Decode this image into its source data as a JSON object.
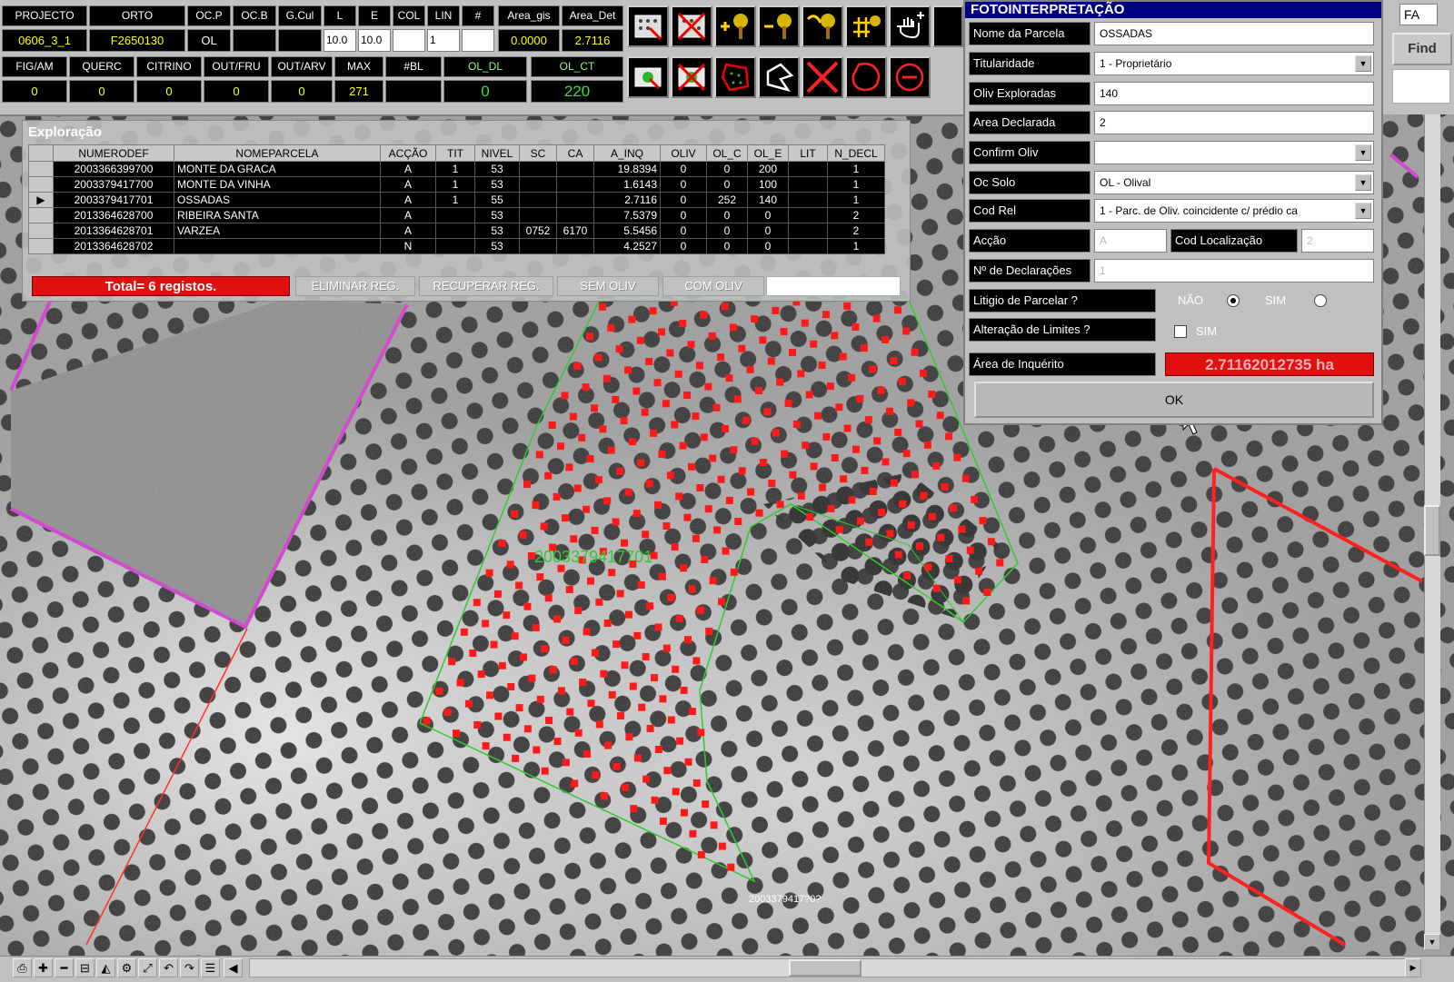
{
  "header": {
    "labels_row1": [
      "PROJECTO",
      "ORTO",
      "OC.P",
      "OC.B",
      "G.Cul",
      "L",
      "E",
      "COL",
      "LIN",
      "#",
      "Area_gis",
      "Area_Det"
    ],
    "values_row1": [
      "0606_3_1",
      "F2650130",
      "OL",
      "",
      "",
      "10.0",
      "10.0",
      "",
      "1",
      "",
      "0.0000",
      "2.7116"
    ],
    "labels_row2": [
      "FIG/AM",
      "QUERC",
      "CITRINO",
      "OUT/FRU",
      "OUT/ARV",
      "MAX",
      "#BL",
      "OL_DL",
      "OL_CT"
    ],
    "values_row2": [
      "0",
      "0",
      "0",
      "0",
      "0",
      "271",
      "",
      "0",
      "220"
    ]
  },
  "toolbar_icons": [
    "select-trees-icon",
    "delete-trees-icon",
    "add-tree-icon",
    "remove-tree-icon",
    "move-tree-icon",
    "tree-grid-icon",
    "hand-pan-icon",
    "select-area-icon",
    "delete-area-icon",
    "draw-polygon-icon",
    "edit-polygon-icon",
    "delete-x-icon",
    "draw-circle-icon",
    "remove-circle-icon"
  ],
  "exploracao": {
    "title": "Exploração",
    "columns": [
      "NUMERODEF",
      "NOMEPARCELA",
      "ACÇÃO",
      "TIT",
      "NIVEL",
      "SC",
      "CA",
      "A_INQ",
      "OLIV",
      "OL_C",
      "OL_E",
      "LIT",
      "N_DECL"
    ],
    "rows": [
      [
        "2003366399700",
        "MONTE DA GRACA",
        "A",
        "1",
        "53",
        "",
        "",
        "19.8394",
        "0",
        "0",
        "200",
        "",
        "1"
      ],
      [
        "2003379417700",
        "MONTE DA VINHA",
        "A",
        "1",
        "53",
        "",
        "",
        "1.6143",
        "0",
        "0",
        "100",
        "",
        "1"
      ],
      [
        "2003379417701",
        "OSSADAS",
        "A",
        "1",
        "55",
        "",
        "",
        "2.7116",
        "0",
        "252",
        "140",
        "",
        "1"
      ],
      [
        "2013364628700",
        "RIBEIRA SANTA",
        "A",
        "",
        "53",
        "",
        "",
        "7.5379",
        "0",
        "0",
        "0",
        "",
        "2"
      ],
      [
        "2013364628701",
        "VARZEA",
        "A",
        "",
        "53",
        "0752",
        "6170",
        "5.5456",
        "0",
        "0",
        "0",
        "",
        "2"
      ],
      [
        "2013364628702",
        "",
        "N",
        "",
        "53",
        "",
        "",
        "4.2527",
        "0",
        "0",
        "0",
        "",
        "1"
      ]
    ],
    "selected_row": 2,
    "total": "Total= 6 registos.",
    "buttons": [
      "ELIMINAR REG.",
      "RECUPERAR REG.",
      "SEM OLIV",
      "COM OLIV"
    ]
  },
  "foto": {
    "title": "FOTOINTERPRETAÇÃO",
    "nome_label": "Nome da Parcela",
    "nome_value": "OSSADAS",
    "tit_label": "Titularidade",
    "tit_value": "1 - Proprietário",
    "oliv_label": "Oliv Exploradas",
    "oliv_value": "140",
    "area_dec_label": "Area Declarada",
    "area_dec_value": "2",
    "confirm_label": "Confirm Oliv",
    "confirm_value": "",
    "oc_label": "Oc Solo",
    "oc_value": "OL - Olival",
    "codrel_label": "Cod Rel",
    "codrel_value": "1 - Parc. de Oliv. coincidente c/ prédio ca",
    "accao_label": "Acção",
    "accao_value": "A",
    "codloc_label": "Cod Localização",
    "codloc_value": "2",
    "ndecl_label": "Nº de Declarações",
    "ndecl_value": "1",
    "litigio_label": "Litigio de Parcelar ?",
    "nao_label": "NÃO",
    "sim_label": "SIM",
    "litigio_selected": "NÃO",
    "alter_label": "Alteração de Limites ?",
    "alter_sim_label": "SIM",
    "alter_checked": false,
    "area_inq_label": "Área de Inquérito",
    "area_inq_value": "2.71162012735 ha",
    "ok_label": "OK"
  },
  "right_panel": {
    "fa_value": "FA",
    "find_label": "Find"
  },
  "map": {
    "parcel_label": "2003379417701",
    "parcel_label_small": "2003379417?0?",
    "colors": {
      "parcel_outline": "#2ecc2e",
      "tree_marker": "#ff1a1a",
      "neighbor_outline": "#ff2020",
      "boundary": "#d24ad2"
    }
  },
  "bottom_tools": [
    "print-icon",
    "zoom-in-icon",
    "zoom-out-icon",
    "zoom-box-icon",
    "layers-icon",
    "settings-icon",
    "measure-icon",
    "undo-icon",
    "redo-icon",
    "list-icon",
    "scroll-left-icon"
  ]
}
